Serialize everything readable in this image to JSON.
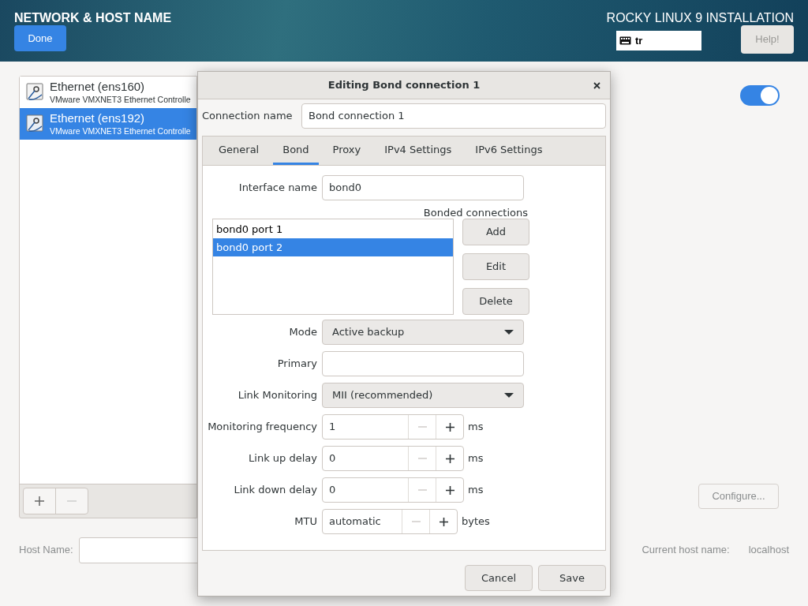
{
  "header": {
    "title": "NETWORK & HOST NAME",
    "done_button": "Done",
    "product": "ROCKY LINUX 9 INSTALLATION",
    "keyboard_layout": "tr",
    "help_button": "Help!"
  },
  "connections": [
    {
      "name": "Ethernet (ens160)",
      "device": "VMware VMXNET3 Ethernet Controlle",
      "selected": false
    },
    {
      "name": "Ethernet (ens192)",
      "device": "VMware VMXNET3 Ethernet Controlle",
      "selected": true
    }
  ],
  "list_toolbar": {
    "remove_enabled": false
  },
  "ethernet_toggle": {
    "on": true
  },
  "configure_button": {
    "label": "Configure...",
    "disabled": true
  },
  "host_name": {
    "label": "Host Name:"
  },
  "current_host_name": {
    "label": "Current host name:",
    "value": "localhost"
  },
  "dialog": {
    "title": "Editing Bond connection 1",
    "connection_name": {
      "label": "Connection name",
      "value": "Bond connection 1"
    },
    "tabs": [
      {
        "label": "General",
        "selected": false
      },
      {
        "label": "Bond",
        "selected": true
      },
      {
        "label": "Proxy",
        "selected": false
      },
      {
        "label": "IPv4 Settings",
        "selected": false
      },
      {
        "label": "IPv6 Settings",
        "selected": false
      }
    ],
    "interface_name": {
      "label": "Interface name",
      "value": "bond0"
    },
    "bonded_connections": {
      "label": "Bonded connections",
      "items": [
        {
          "label": "bond0 port 1",
          "selected": false
        },
        {
          "label": "bond0 port 2",
          "selected": true
        }
      ],
      "buttons": [
        "Add",
        "Edit",
        "Delete"
      ]
    },
    "fields": [
      {
        "kind": "dropdown",
        "label": "Mode",
        "value": "Active backup"
      },
      {
        "kind": "entry",
        "label": "Primary"
      },
      {
        "kind": "dropdown",
        "label": "Link Monitoring",
        "value": "MII (recommended)"
      },
      {
        "kind": "spin",
        "label": "Monitoring frequency",
        "value": "1",
        "unit": "ms",
        "decrease_enabled": false
      },
      {
        "kind": "spin",
        "label": "Link up delay",
        "value": "0",
        "unit": "ms",
        "decrease_enabled": false
      },
      {
        "kind": "spin",
        "label": "Link down delay",
        "value": "0",
        "unit": "ms",
        "decrease_enabled": false
      },
      {
        "kind": "spin",
        "label": "MTU",
        "value": "automatic",
        "unit": "bytes",
        "decrease_enabled": false
      }
    ],
    "buttons": [
      "Cancel",
      "Save"
    ]
  }
}
